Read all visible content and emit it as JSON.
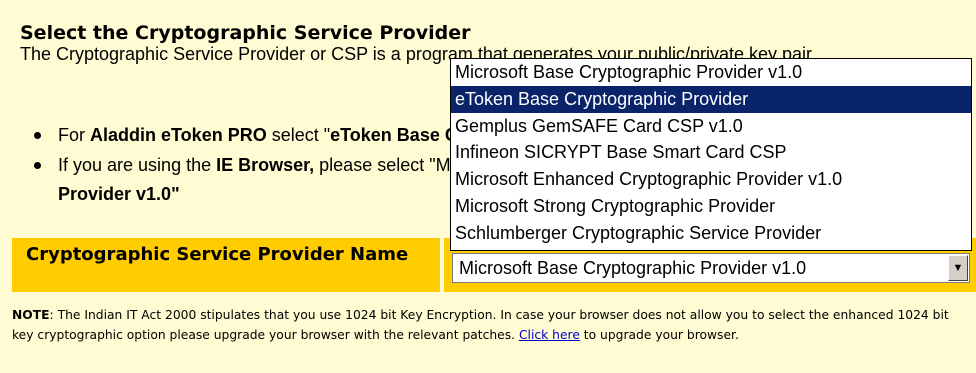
{
  "heading": "Select the Cryptographic Service Provider",
  "intro": "The Cryptographic Service Provider or CSP is a program that generates your public/private key pair.",
  "bullets": {
    "b1_pre": "For ",
    "b1_bold": "Aladdin eToken PRO",
    "b1_mid": " select \"",
    "b1_hidden": "eToken Base Cryptographic Provider\"",
    "b2_pre": "If you are using the ",
    "b2_bold": "IE Browser,",
    "b2_rest": " please select \"Microsoft Base Cryptographic",
    "b2_cont": "Provider v1.0\""
  },
  "csp": {
    "label": "Cryptographic Service Provider Name",
    "selected": "Microsoft Base Cryptographic Provider v1.0"
  },
  "dropdown": {
    "options": [
      "Microsoft Base Cryptographic Provider v1.0",
      "eToken Base Cryptographic Provider",
      "Gemplus GemSAFE Card CSP v1.0",
      "Infineon SICRYPT Base Smart Card CSP",
      "Microsoft Enhanced Cryptographic Provider v1.0",
      "Microsoft Strong Cryptographic Provider",
      "Schlumberger Cryptographic Service Provider"
    ],
    "highlighted_index": 1
  },
  "note": {
    "label": "NOTE",
    "text": ": The Indian IT Act 2000 stipulates that you use 1024 bit Key Encryption. In case your browser does not allow you to select the enhanced 1024 bit key cryptographic option please upgrade your browser with the relevant patches. ",
    "link": "Click here",
    "after": " to upgrade your browser."
  }
}
